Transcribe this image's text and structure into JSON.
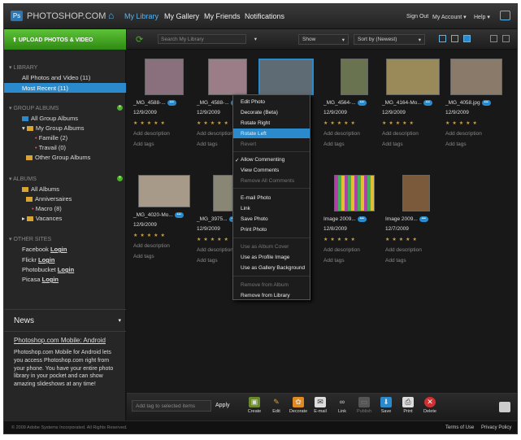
{
  "header": {
    "logo_mark": "Ps",
    "logo": "PHOTOSHOP.COM",
    "nav": [
      "My Library",
      "My Gallery",
      "My Friends",
      "Notifications"
    ],
    "right": [
      "Sign Out",
      "My Account ▾",
      "Help ▾"
    ]
  },
  "sidebar": {
    "upload": "UPLOAD PHOTOS & VIDEO",
    "library_title": "LIBRARY",
    "library": [
      "All Photos and Video (11)",
      "Most Recent (11)"
    ],
    "group_title": "GROUP ALBUMS",
    "groups": [
      "All Group Albums",
      "My Group Albums",
      "Famille (2)",
      "Travail (0)",
      "Other Group Albums"
    ],
    "albums_title": "ALBUMS",
    "albums": [
      "All Albums",
      "Anniversaires",
      "Macro (8)",
      "Vacances"
    ],
    "other_title": "OTHER SITES",
    "other": [
      {
        "name": "Facebook",
        "login": "Login"
      },
      {
        "name": "Flickr",
        "login": "Login"
      },
      {
        "name": "Photobucket",
        "login": "Login"
      },
      {
        "name": "Picasa",
        "login": "Login"
      }
    ],
    "news": "News",
    "mobile_title": "Photoshop.com Mobile: Android",
    "mobile_text": "Photoshop.com Mobile for Android lets you access Photoshop.com right from your phone. You have your entire photo library in your pocket and can show amazing slideshows at any time!"
  },
  "toolbar": {
    "search_placeholder": "Search My Library",
    "show": "Show",
    "sort": "Sort by (Newest)"
  },
  "photos": [
    {
      "name": "_MG_4588-...",
      "date": "12/9/2009",
      "desc": "Add description",
      "tags": "Add tags",
      "color": "#8a6f7d"
    },
    {
      "name": "_MG_4588-...",
      "date": "12/9/2009",
      "desc": "Add description",
      "tags": "Add tags",
      "color": "#9a7d86"
    },
    {
      "name": "",
      "date": "",
      "desc": "",
      "tags": "",
      "color": "#5f6b74"
    },
    {
      "name": "_MG_4564-...",
      "date": "12/9/2009",
      "desc": "Add description",
      "tags": "Add tags",
      "color": "#6a7350"
    },
    {
      "name": "_MG_4164-Mo...",
      "date": "12/9/2009",
      "desc": "Add description",
      "tags": "Add tags",
      "color": "#9a8a5a"
    },
    {
      "name": "_MG_4058.jpg",
      "date": "12/9/2009",
      "desc": "Add description",
      "tags": "Add tags",
      "color": "#8a7a6a"
    },
    {
      "name": "_MG_4020-Mo...",
      "date": "12/9/2009",
      "desc": "Add description",
      "tags": "Add tags",
      "color": "#a89a88"
    },
    {
      "name": "_MG_3975...",
      "date": "12/9/2009",
      "desc": "Add description",
      "tags": "Add tags",
      "color": "#8a8676"
    },
    {
      "name": "Image 2009...",
      "date": "12/8/2009",
      "desc": "Add description",
      "tags": "Add tags",
      "color": "#6a5a3a"
    },
    {
      "name": "Image 2009...",
      "date": "12/7/2009",
      "desc": "Add description",
      "tags": "Add tags",
      "color": "#7a5a3a"
    }
  ],
  "menu": [
    "Edit Photo",
    "Decorate (Beta)",
    "Rotate Right",
    "Rotate Left",
    "Revert",
    "Allow Commenting",
    "View Comments",
    "Remove All Comments",
    "E-mail Photo",
    "Link",
    "Save Photo",
    "Print Photo",
    "Use as Album Cover",
    "Use as Profile Image",
    "Use as Gallery Background",
    "Remove from Album",
    "Remove from Library"
  ],
  "bottom": {
    "tag_placeholder": "Add tag to selected items",
    "apply": "Apply",
    "actions": [
      "Create",
      "Edit",
      "Decorate",
      "E-mail",
      "Link",
      "Publish",
      "Save",
      "Print",
      "Delete"
    ]
  },
  "footer": {
    "copy": "© 2009 Adobe Systems Incorporated. All Rights Reserved.",
    "links": [
      "Terms of Use",
      "Privacy Policy"
    ]
  }
}
